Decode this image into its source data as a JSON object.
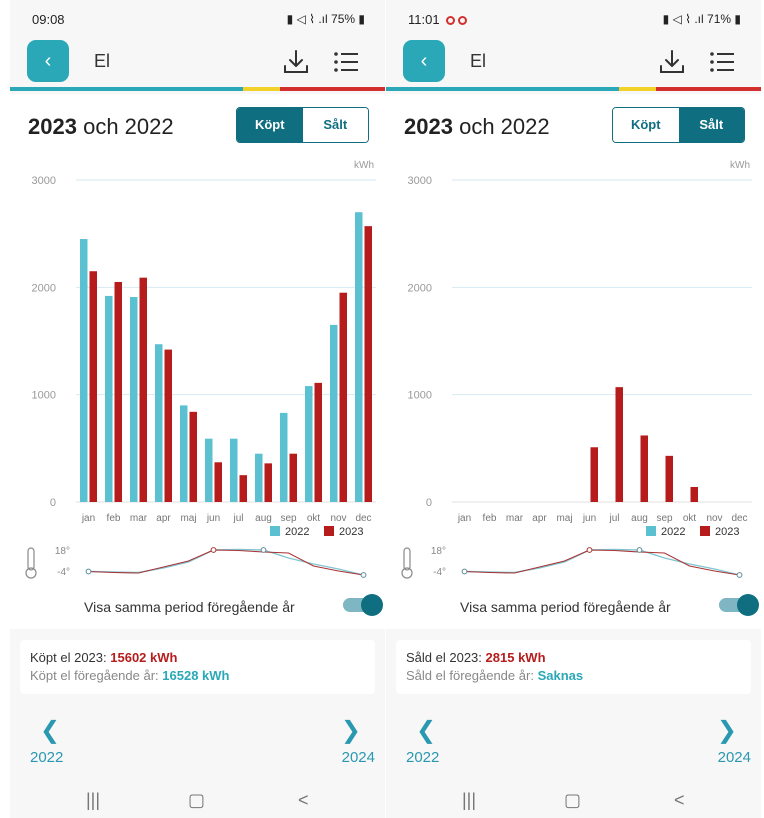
{
  "screens": [
    {
      "status": {
        "time": "09:08",
        "battery": "75%",
        "red_dots": 0
      },
      "app_title": "El",
      "period": {
        "year_bold": "2023",
        "rest": "och 2022"
      },
      "toggle": {
        "bought": "Köpt",
        "sold": "Sålt",
        "active": "bought"
      },
      "chart_data": {
        "type": "bar",
        "unit": "kWh",
        "categories": [
          "jan",
          "feb",
          "mar",
          "apr",
          "maj",
          "jun",
          "jul",
          "aug",
          "sep",
          "okt",
          "nov",
          "dec"
        ],
        "series": [
          {
            "name": "2022",
            "color": "#5bc0d0",
            "values": [
              2450,
              1920,
              1910,
              1470,
              900,
              590,
              590,
              450,
              830,
              1080,
              1650,
              2700
            ]
          },
          {
            "name": "2023",
            "color": "#b71c1c",
            "values": [
              2150,
              2050,
              2090,
              1420,
              840,
              370,
              250,
              360,
              450,
              1110,
              1950,
              2570
            ]
          }
        ],
        "ylim": [
          0,
          3000
        ],
        "yticks": [
          0,
          1000,
          2000,
          3000
        ],
        "grid": true,
        "legend_position": "bottom-right"
      },
      "temperature": {
        "max_label": "18°",
        "min_label": "-4°",
        "series_2022": [
          -3.5,
          -4,
          -4.5,
          0,
          6,
          18,
          18.5,
          18,
          10,
          4,
          -1,
          -7
        ],
        "series_2023": [
          -3.5,
          -4.5,
          -5,
          1,
          7,
          18,
          17.5,
          16,
          15,
          2,
          -3,
          -7
        ]
      },
      "show_previous": {
        "label": "Visa samma period föregående år",
        "on": true
      },
      "summary": {
        "line1_label": "Köpt el 2023:",
        "line1_value": "15602 kWh",
        "line2_label": "Köpt el föregående år:",
        "line2_value": "16528 kWh"
      },
      "nav": {
        "prev_year": "2022",
        "next_year": "2024"
      }
    },
    {
      "status": {
        "time": "11:01",
        "battery": "71%",
        "red_dots": 2
      },
      "app_title": "El",
      "period": {
        "year_bold": "2023",
        "rest": "och 2022"
      },
      "toggle": {
        "bought": "Köpt",
        "sold": "Sålt",
        "active": "sold"
      },
      "chart_data": {
        "type": "bar",
        "unit": "kWh",
        "categories": [
          "jan",
          "feb",
          "mar",
          "apr",
          "maj",
          "jun",
          "jul",
          "aug",
          "sep",
          "okt",
          "nov",
          "dec"
        ],
        "series": [
          {
            "name": "2022",
            "color": "#5bc0d0",
            "values": [
              0,
              0,
              0,
              0,
              0,
              0,
              0,
              0,
              0,
              0,
              0,
              0
            ]
          },
          {
            "name": "2023",
            "color": "#b71c1c",
            "values": [
              0,
              0,
              0,
              0,
              0,
              510,
              1070,
              620,
              430,
              140,
              0,
              0
            ]
          }
        ],
        "ylim": [
          0,
          3000
        ],
        "yticks": [
          0,
          1000,
          2000,
          3000
        ],
        "grid": true,
        "legend_position": "bottom-right"
      },
      "temperature": {
        "max_label": "18°",
        "min_label": "-4°",
        "series_2022": [
          -3.5,
          -4,
          -4.5,
          0,
          6,
          18,
          18.5,
          18,
          10,
          4,
          -1,
          -7
        ],
        "series_2023": [
          -3.5,
          -4.5,
          -5,
          1,
          7,
          18,
          17.5,
          16,
          15,
          2,
          -3,
          -7
        ]
      },
      "show_previous": {
        "label": "Visa samma period föregående år",
        "on": true
      },
      "summary": {
        "line1_label": "Såld el 2023:",
        "line1_value": "2815 kWh",
        "line2_label": "Såld el föregående år:",
        "line2_value": "Saknas"
      },
      "nav": {
        "prev_year": "2022",
        "next_year": "2024"
      }
    }
  ]
}
